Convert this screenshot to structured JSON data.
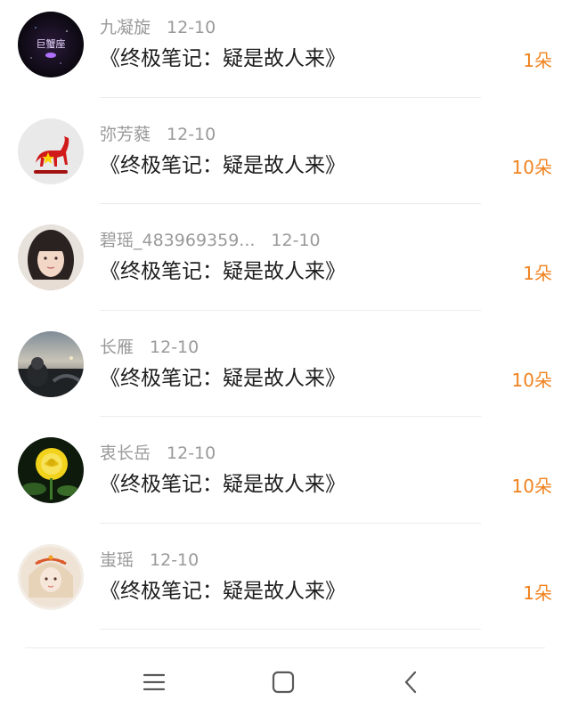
{
  "rows": [
    {
      "name": "九凝旋",
      "date": "12-10",
      "gift": "《终极笔记：疑是故人来》",
      "count": "1朵",
      "avatar_icon": "constellation-avatar-icon",
      "avatar_text": "巨蟹座"
    },
    {
      "name": "弥芳蕤",
      "date": "12-10",
      "gift": "《终极笔记：疑是故人来》",
      "count": "10朵",
      "avatar_icon": "red-horse-avatar-icon"
    },
    {
      "name": "碧瑶_483969359...",
      "date": "12-10",
      "gift": "《终极笔记：疑是故人来》",
      "count": "1朵",
      "avatar_icon": "girl-portrait-avatar-icon"
    },
    {
      "name": "长雁",
      "date": "12-10",
      "gift": "《终极笔记：疑是故人来》",
      "count": "10朵",
      "avatar_icon": "car-interior-avatar-icon"
    },
    {
      "name": "衷长岳",
      "date": "12-10",
      "gift": "《终极笔记：疑是故人来》",
      "count": "10朵",
      "avatar_icon": "yellow-rose-avatar-icon"
    },
    {
      "name": "蚩瑶",
      "date": "12-10",
      "gift": "《终极笔记：疑是故人来》",
      "count": "1朵",
      "avatar_icon": "illustrated-girl-avatar-icon"
    }
  ],
  "colors": {
    "count": "#f0821e",
    "meta": "#9a9a9a",
    "text": "#1e1e1e",
    "divider": "#ececec"
  },
  "navbar": {
    "menu_icon": "menu-icon",
    "home_icon": "home-square-icon",
    "back_icon": "back-chevron-icon"
  }
}
